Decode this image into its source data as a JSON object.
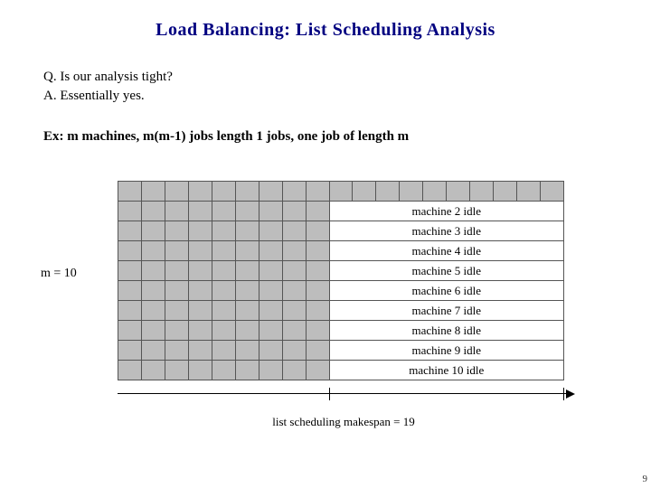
{
  "title": "Load Balancing:  List Scheduling Analysis",
  "q_label": "Q.",
  "q_text": "Is our analysis tight?",
  "a_label": "A.",
  "a_text": "Essentially yes.",
  "ex_text": "Ex:  m machines, m(m-1) jobs length 1 jobs, one job of length m",
  "m_label": "m = 10",
  "idle_labels": [
    "machine 2 idle",
    "machine 3 idle",
    "machine 4 idle",
    "machine 5 idle",
    "machine 6 idle",
    "machine 7 idle",
    "machine 8 idle",
    "machine 9 idle",
    "machine 10 idle"
  ],
  "caption": "list scheduling makespan = 19",
  "page_number": "9",
  "chart_data": {
    "type": "table",
    "machines": 10,
    "unit_jobs_per_machine": 9,
    "long_job_length": 10,
    "makespan": 19,
    "rows": [
      {
        "machine": 1,
        "busy_until": 19,
        "idle": false
      },
      {
        "machine": 2,
        "busy_until": 9,
        "idle": true
      },
      {
        "machine": 3,
        "busy_until": 9,
        "idle": true
      },
      {
        "machine": 4,
        "busy_until": 9,
        "idle": true
      },
      {
        "machine": 5,
        "busy_until": 9,
        "idle": true
      },
      {
        "machine": 6,
        "busy_until": 9,
        "idle": true
      },
      {
        "machine": 7,
        "busy_until": 9,
        "idle": true
      },
      {
        "machine": 8,
        "busy_until": 9,
        "idle": true
      },
      {
        "machine": 9,
        "busy_until": 9,
        "idle": true
      },
      {
        "machine": 10,
        "busy_until": 9,
        "idle": true
      }
    ],
    "axis_ticks": [
      9,
      19
    ]
  }
}
